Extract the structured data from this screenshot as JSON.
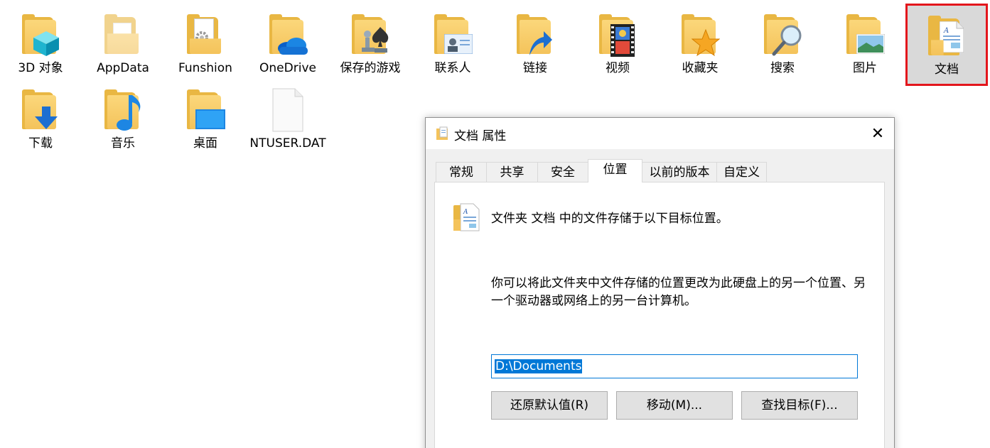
{
  "desktop": {
    "items": [
      {
        "label": "3D 对象"
      },
      {
        "label": "AppData"
      },
      {
        "label": "Funshion"
      },
      {
        "label": "OneDrive"
      },
      {
        "label": "保存的游戏"
      },
      {
        "label": "联系人"
      },
      {
        "label": "链接"
      },
      {
        "label": "视频"
      },
      {
        "label": "收藏夹"
      },
      {
        "label": "搜索"
      },
      {
        "label": "图片"
      },
      {
        "label": "文档"
      },
      {
        "label": "下载"
      },
      {
        "label": "音乐"
      },
      {
        "label": "桌面"
      },
      {
        "label": "NTUSER.DAT"
      }
    ]
  },
  "dialog": {
    "title": "文档 属性",
    "close_glyph": "✕",
    "tabs": [
      {
        "label": "常规"
      },
      {
        "label": "共享"
      },
      {
        "label": "安全"
      },
      {
        "label": "位置"
      },
      {
        "label": "以前的版本"
      },
      {
        "label": "自定义"
      }
    ],
    "active_tab": "位置",
    "heading": "文件夹 文档 中的文件存储于以下目标位置。",
    "description": "你可以将此文件夹中文件存储的位置更改为此硬盘上的另一个位置、另一个驱动器或网络上的另一台计算机。",
    "path_value": "D:\\Documents",
    "buttons": {
      "restore": "还原默认值(R)",
      "move": "移动(M)...",
      "find": "查找目标(F)..."
    }
  },
  "colors": {
    "folder": "#f4c35b",
    "selection_outline": "#e3161c",
    "selection_bg": "#d9d9d9",
    "accent": "#0078d7"
  }
}
